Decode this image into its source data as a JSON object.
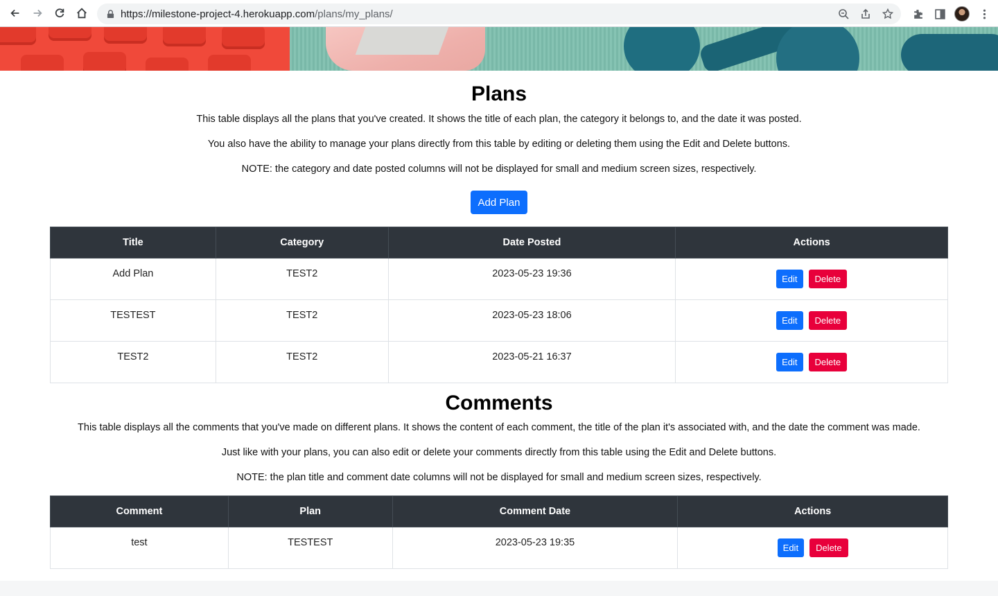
{
  "browser": {
    "url_host": "https://milestone-project-4.herokuapp.com",
    "url_path": "/plans/my_plans/"
  },
  "plans_section": {
    "title": "Plans",
    "paragraphs": [
      "This table displays all the plans that you've created. It shows the title of each plan, the category it belongs to, and the date it was posted.",
      "You also have the ability to manage your plans directly from this table by editing or deleting them using the Edit and Delete buttons.",
      "NOTE: the category and date posted columns will not be displayed for small and medium screen sizes, respectively."
    ],
    "add_button_label": "Add Plan",
    "columns": [
      "Title",
      "Category",
      "Date Posted",
      "Actions"
    ],
    "rows": [
      {
        "title": "Add Plan",
        "category": "TEST2",
        "date": "2023-05-23 19:36"
      },
      {
        "title": "TESTEST",
        "category": "TEST2",
        "date": "2023-05-23 18:06"
      },
      {
        "title": "TEST2",
        "category": "TEST2",
        "date": "2023-05-21 16:37"
      }
    ]
  },
  "comments_section": {
    "title": "Comments",
    "paragraphs": [
      "This table displays all the comments that you've made on different plans. It shows the content of each comment, the title of the plan it's associated with, and the date the comment was made.",
      "Just like with your plans, you can also edit or delete your comments directly from this table using the Edit and Delete buttons.",
      "NOTE: the plan title and comment date columns will not be displayed for small and medium screen sizes, respectively."
    ],
    "columns": [
      "Comment",
      "Plan",
      "Comment Date",
      "Actions"
    ],
    "rows": [
      {
        "comment": "test",
        "plan": "TESTEST",
        "date": "2023-05-23 19:35"
      }
    ]
  },
  "actions": {
    "edit_label": "Edit",
    "delete_label": "Delete"
  },
  "colors": {
    "primary": "#0d6efd",
    "danger": "#e8003b",
    "table_header": "#2f353c"
  }
}
